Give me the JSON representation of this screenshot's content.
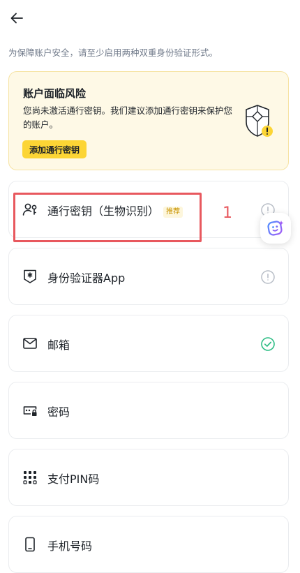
{
  "header": {
    "back_icon": "arrow-left-icon"
  },
  "subtitle": "为保障账户安全，请至少启用两种双重身份验证形式。",
  "risk": {
    "title": "账户面临风险",
    "description": "您尚未激活通行密钥。我们建议添加通行密钥来保护您的账户。",
    "button_label": "添加通行密钥",
    "illustration_icon": "shield-warning-icon"
  },
  "methods": [
    {
      "label": "通行密钥（生物识别）",
      "badge": "推荐",
      "icon": "user-key-icon",
      "status": "info"
    },
    {
      "label": "身份验证器App",
      "icon": "authenticator-icon",
      "status": "info"
    },
    {
      "label": "邮箱",
      "icon": "mail-icon",
      "status": "enabled"
    },
    {
      "label": "密码",
      "icon": "password-icon",
      "status": "none"
    },
    {
      "label": "支付PIN码",
      "icon": "pin-keypad-icon",
      "status": "none"
    },
    {
      "label": "手机号码",
      "icon": "phone-icon",
      "status": "none"
    }
  ],
  "annotation": {
    "number": "1",
    "color": "#e8585e"
  },
  "colors": {
    "accent": "#fcd535",
    "success": "#2ebd85",
    "text": "#1e2329",
    "muted": "#707a8a"
  }
}
